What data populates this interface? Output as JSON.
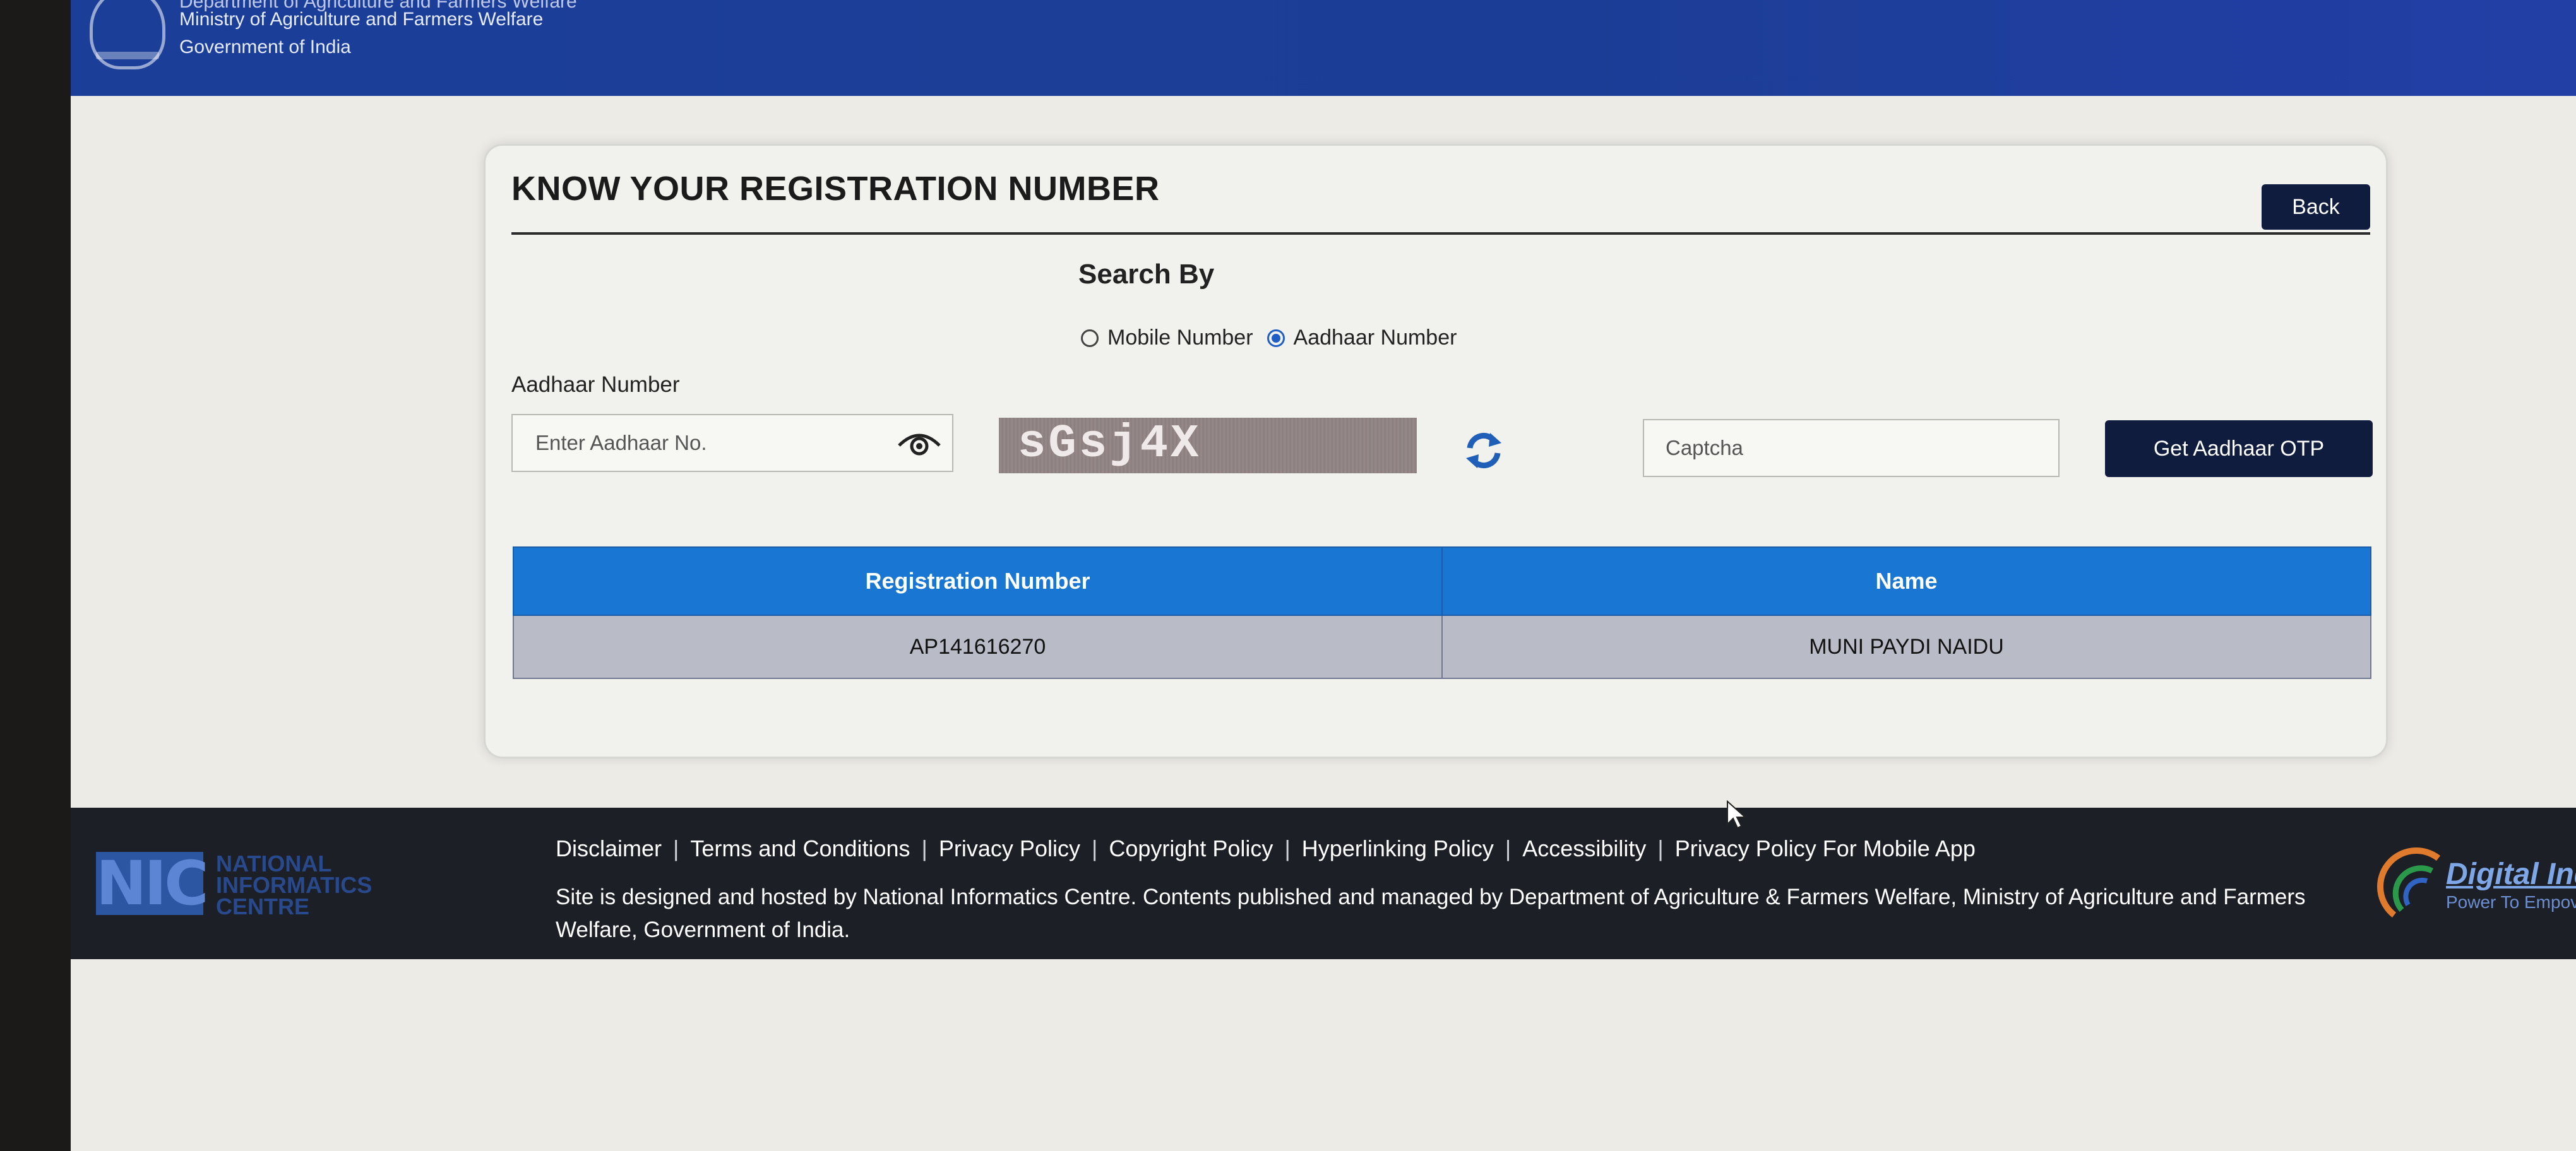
{
  "header": {
    "top_line": "Department of Agriculture and Farmers Welfare",
    "ministry": "Ministry of Agriculture and Farmers Welfare",
    "government": "Government of India",
    "emblem_icon": "emblem-icon"
  },
  "card": {
    "title": "KNOW YOUR REGISTRATION NUMBER",
    "back_label": "Back",
    "search_by": "Search By",
    "radio_options": [
      {
        "label": "Mobile Number",
        "selected": false
      },
      {
        "label": "Aadhaar Number",
        "selected": true
      }
    ],
    "aadhaar_label": "Aadhaar Number",
    "aadhaar_placeholder": "Enter Aadhaar No.",
    "captcha_text": "sGsj4X",
    "captcha_placeholder": "Captcha",
    "otp_label": "Get Aadhaar OTP"
  },
  "table": {
    "headers": [
      "Registration Number",
      "Name"
    ],
    "rows": [
      [
        "AP141616270",
        "MUNI PAYDI NAIDU"
      ]
    ]
  },
  "footer": {
    "nic_logo": "NIC",
    "nic_name": [
      "NATIONAL",
      "INFORMATICS",
      "CENTRE"
    ],
    "links": [
      "Disclaimer",
      "Terms and Conditions",
      "Privacy Policy",
      "Copyright Policy",
      "Hyperlinking Policy",
      "Accessibility",
      "Privacy Policy For Mobile App"
    ],
    "separator": "|",
    "text": "Site is designed and hosted by National Informatics Centre. Contents published and managed by Department of Agriculture & Farmers Welfare, Ministry of Agriculture and Farmers Welfare, Government of India.",
    "digital_india_title": "Digital Ind",
    "digital_india_tagline": "Power To Empov"
  },
  "colors": {
    "header_blue": "#1b3f99",
    "button_navy": "#0f1c3d",
    "table_header": "#1976d2",
    "footer_bg": "#1d1f27"
  }
}
